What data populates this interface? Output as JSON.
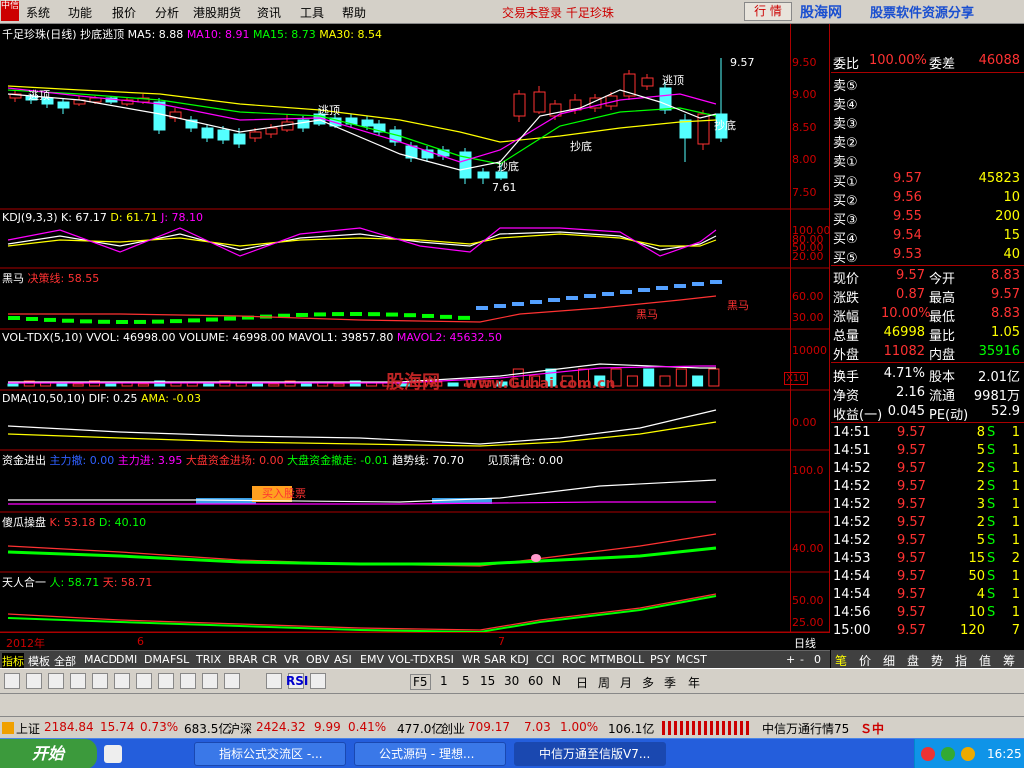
{
  "menubar": {
    "logo": "中信",
    "items": [
      "系统",
      "功能",
      "报价",
      "分析",
      "港股期货",
      "资讯",
      "工具",
      "帮助"
    ],
    "notice": "交易未登录 千足珍珠",
    "hq_button": "行 情",
    "brand": "股海网",
    "brand_slogan": "股票软件资源分享",
    "brand_url": "www.Guhai.com.cn"
  },
  "kline_panel": {
    "title": "千足珍珠(日线) 抄底逃顶",
    "ma5": "MA5: 8.88",
    "ma10": "MA10: 8.91",
    "ma15": "MA15: 8.73",
    "ma30": "MA30: 8.54",
    "axis": [
      "9.50",
      "9.00",
      "8.50",
      "8.00",
      "7.50"
    ],
    "markers": [
      "逃顶",
      "逃顶",
      "逃顶",
      "抄底",
      "抄底",
      "抄底"
    ],
    "high_label": "9.57",
    "low_label": "7.61"
  },
  "kdj_panel": {
    "title": "KDJ(9,3,3)",
    "k": "K: 67.17",
    "d": "D: 61.71",
    "j": "J: 78.10",
    "axis": [
      "100.00",
      "80.00",
      "50.00",
      "20.00"
    ]
  },
  "heima_panel": {
    "title": "黑马",
    "decision": "决策线: 58.55",
    "axis": [
      "60.00",
      "30.00"
    ],
    "marker": "黑马"
  },
  "vol_panel": {
    "title": "VOL-TDX(5,10)",
    "vvol": "VVOL: 46998.00",
    "volume": "VOLUME: 46998.00",
    "mavol1": "MAVOL1: 39857.80",
    "mavol2": "MAVOL2: 45632.50",
    "axis": [
      "10000"
    ],
    "unit": "X10"
  },
  "dma_panel": {
    "title": "DMA(10,50,10)",
    "dif": "DIF: 0.25",
    "ama": "AMA: -0.03",
    "axis": [
      "0.00"
    ]
  },
  "fund_panel": {
    "title": "资金进出",
    "main_out": "主力撤: 0.00",
    "main_in": "主力进: 3.95",
    "big_in": "大盘资金进场: 0.00",
    "big_out": "大盘资金撤走: -0.01",
    "trend": "趋势线: 70.70",
    "top_clear": "见顶清仓: 0.00",
    "note": "买入股票",
    "axis": [
      "100.0"
    ]
  },
  "sg_panel": {
    "title": "傻瓜操盘",
    "k": "K: 53.18",
    "d": "D: 40.10",
    "axis": [
      "40.00"
    ]
  },
  "trh_panel": {
    "title": "天人合一",
    "ren": "人: 58.71",
    "tian": "天: 58.71",
    "axis": [
      "50.00",
      "25.00"
    ]
  },
  "date_axis": {
    "labels": [
      "2012年",
      "6",
      "7"
    ],
    "period": "日线"
  },
  "bottom_tabs": [
    "指标",
    "模板",
    "全部",
    "MACD",
    "DMI",
    "DMA",
    "FSL",
    "TRIX",
    "BRAR",
    "CR",
    "VR",
    "OBV",
    "ASI",
    "EMV",
    "VOL-TDX",
    "RSI",
    "WR",
    "SAR",
    "KDJ",
    "CCI",
    "ROC",
    "MTM",
    "BOLL",
    "PSY",
    "MCST"
  ],
  "tab_controls": [
    "+",
    "-",
    "0"
  ],
  "side_tabs": [
    "笔",
    "价",
    "细",
    "盘",
    "势",
    "指",
    "值",
    "筹"
  ],
  "quote": {
    "weibi": {
      "label": "委比",
      "value": "100.00%",
      "label2": "委差",
      "value2": "46088"
    },
    "sells": [
      {
        "label": "卖⑤",
        "price": "",
        "vol": ""
      },
      {
        "label": "卖④",
        "price": "",
        "vol": ""
      },
      {
        "label": "卖③",
        "price": "",
        "vol": ""
      },
      {
        "label": "卖②",
        "price": "",
        "vol": ""
      },
      {
        "label": "卖①",
        "price": "",
        "vol": ""
      }
    ],
    "buys": [
      {
        "label": "买①",
        "price": "9.57",
        "vol": "45823"
      },
      {
        "label": "买②",
        "price": "9.56",
        "vol": "10"
      },
      {
        "label": "买③",
        "price": "9.55",
        "vol": "200"
      },
      {
        "label": "买④",
        "price": "9.54",
        "vol": "15"
      },
      {
        "label": "买⑤",
        "price": "9.53",
        "vol": "40"
      }
    ],
    "stats": [
      {
        "l1": "现价",
        "v1": "9.57",
        "l2": "今开",
        "v2": "8.83"
      },
      {
        "l1": "涨跌",
        "v1": "0.87",
        "l2": "最高",
        "v2": "9.57"
      },
      {
        "l1": "涨幅",
        "v1": "10.00%",
        "l2": "最低",
        "v2": "8.83"
      },
      {
        "l1": "总量",
        "v1": "46998",
        "l2": "量比",
        "v2": "1.05"
      },
      {
        "l1": "外盘",
        "v1": "11082",
        "l2": "内盘",
        "v2": "35916"
      }
    ],
    "stats2": [
      {
        "l1": "换手",
        "v1": "4.71%",
        "l2": "股本",
        "v2": "2.01亿"
      },
      {
        "l1": "净资",
        "v1": "2.16",
        "l2": "流通",
        "v2": "9981万"
      },
      {
        "l1": "收益(一)",
        "v1": "0.045",
        "l2": "PE(动)",
        "v2": "52.9"
      }
    ],
    "ticks": [
      {
        "t": "14:51",
        "p": "9.57",
        "v": "8",
        "s": "S",
        "n": "1"
      },
      {
        "t": "14:51",
        "p": "9.57",
        "v": "5",
        "s": "S",
        "n": "1"
      },
      {
        "t": "14:52",
        "p": "9.57",
        "v": "2",
        "s": "S",
        "n": "1"
      },
      {
        "t": "14:52",
        "p": "9.57",
        "v": "2",
        "s": "S",
        "n": "1"
      },
      {
        "t": "14:52",
        "p": "9.57",
        "v": "3",
        "s": "S",
        "n": "1"
      },
      {
        "t": "14:52",
        "p": "9.57",
        "v": "2",
        "s": "S",
        "n": "1"
      },
      {
        "t": "14:52",
        "p": "9.57",
        "v": "5",
        "s": "S",
        "n": "1"
      },
      {
        "t": "14:53",
        "p": "9.57",
        "v": "15",
        "s": "S",
        "n": "2"
      },
      {
        "t": "14:54",
        "p": "9.57",
        "v": "50",
        "s": "S",
        "n": "1"
      },
      {
        "t": "14:54",
        "p": "9.57",
        "v": "4",
        "s": "S",
        "n": "1"
      },
      {
        "t": "14:56",
        "p": "9.57",
        "v": "10",
        "s": "S",
        "n": "1"
      },
      {
        "t": "15:00",
        "p": "9.57",
        "v": "120",
        "s": "",
        "n": "7"
      }
    ]
  },
  "toolbar": {
    "periods": [
      "1",
      "5",
      "15",
      "30",
      "60",
      "N",
      "日",
      "周",
      "月",
      "多",
      "季",
      "年"
    ],
    "rsi": "RSI",
    "fs": "F5"
  },
  "index_bar": {
    "sh_label": "上证",
    "sh_val": "2184.84",
    "sh_chg": "15.74",
    "sh_pct": "0.73%",
    "sh_amt": "683.5亿",
    "sz_label": "沪深",
    "sz_val": "2424.32",
    "sz_chg": "9.99",
    "sz_pct": "0.41%",
    "sz_amt": "477.0亿",
    "cy_label": "创业",
    "cy_val": "709.17",
    "cy_chg": "7.03",
    "cy_pct": "1.00%",
    "cy_amt": "106.1亿",
    "broker": "中信万通行情75"
  },
  "taskbar": {
    "start": "开始",
    "tasks": [
      "指标公式交流区 -...",
      "公式源码 - 理想...",
      "中信万通至信版V7..."
    ],
    "clock": "16:25"
  },
  "watermark": {
    "main": "股海网",
    "url": "www.Guhai.com.cn"
  },
  "colors": {
    "up": "#ff3232",
    "down": "#54ffff",
    "ma5": "#ffffff",
    "ma10": "#ff00ff",
    "ma15": "#00ff00",
    "ma30": "#ffff00",
    "axis": "#aa0000"
  }
}
